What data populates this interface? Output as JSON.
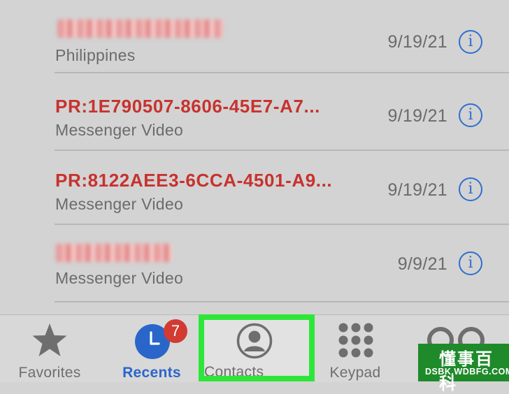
{
  "recents": [
    {
      "title": "",
      "title_style": "blurred",
      "subtitle": "Philippines",
      "date": "9/19/21"
    },
    {
      "title": "PR:1E790507-8606-45E7-A7...",
      "title_style": "red",
      "subtitle": "Messenger Video",
      "date": "9/19/21"
    },
    {
      "title": "PR:8122AEE3-6CCA-4501-A9...",
      "title_style": "red",
      "subtitle": "Messenger Video",
      "date": "9/19/21"
    },
    {
      "title": "",
      "title_style": "blurred",
      "subtitle": "Messenger Video",
      "date": "9/9/21"
    }
  ],
  "info_glyph": "i",
  "tabbar": {
    "favorites": "Favorites",
    "recents": "Recents",
    "recents_badge": "7",
    "contacts": "Contacts",
    "keypad": "Keypad",
    "voicemail": ""
  },
  "watermark": {
    "main": "懂事百科",
    "sub": "DSBK.WDBFG.COM"
  },
  "colors": {
    "accent": "#2a66c9",
    "missed": "#c7322e",
    "highlight": "#2ee63a",
    "badge": "#d23a32"
  }
}
